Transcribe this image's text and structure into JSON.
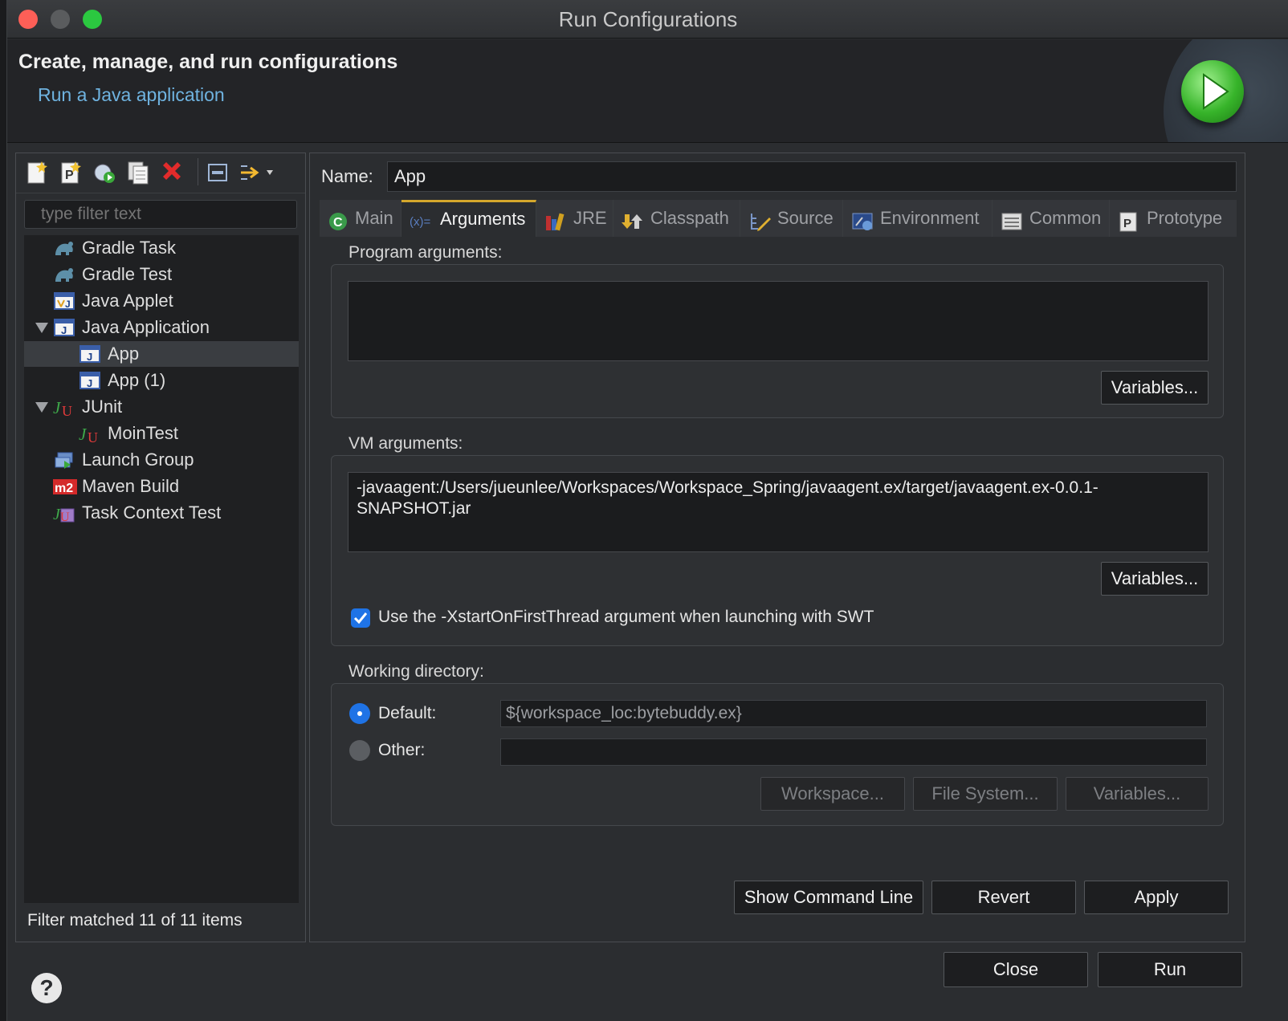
{
  "window": {
    "title": "Run Configurations"
  },
  "header": {
    "title": "Create, manage, and run configurations",
    "subtitle": "Run a Java application"
  },
  "left": {
    "toolbar": [
      {
        "name": "new-config-icon"
      },
      {
        "name": "new-prototype-icon"
      },
      {
        "name": "export-config-icon"
      },
      {
        "name": "duplicate-icon"
      },
      {
        "name": "delete-icon"
      },
      {
        "name": "collapse-all-icon"
      },
      {
        "name": "filter-menu-icon"
      }
    ],
    "filter_placeholder": "type filter text",
    "tree": [
      {
        "label": "Gradle Task",
        "icon": "gradle-icon",
        "level": 1
      },
      {
        "label": "Gradle Test",
        "icon": "gradle-icon",
        "level": 1
      },
      {
        "label": "Java Applet",
        "icon": "applet-icon",
        "level": 1
      },
      {
        "label": "Java Application",
        "icon": "java-app-icon",
        "level": 1,
        "expanded": true
      },
      {
        "label": "App",
        "icon": "java-app-icon",
        "level": 2,
        "selected": true
      },
      {
        "label": "App (1)",
        "icon": "java-app-icon",
        "level": 2
      },
      {
        "label": "JUnit",
        "icon": "junit-icon",
        "level": 1,
        "expanded": true
      },
      {
        "label": "MoinTest",
        "icon": "junit-icon",
        "level": 2
      },
      {
        "label": "Launch Group",
        "icon": "launch-group-icon",
        "level": 1
      },
      {
        "label": "Maven Build",
        "icon": "maven-icon",
        "level": 1
      },
      {
        "label": "Task Context Test",
        "icon": "task-context-icon",
        "level": 1
      }
    ],
    "status": "Filter matched 11 of 11 items"
  },
  "right": {
    "name_label": "Name:",
    "name_value": "App",
    "tabs": [
      {
        "label": "Main",
        "icon": "main-tab-icon",
        "active": false
      },
      {
        "label": "Arguments",
        "icon": "arguments-tab-icon",
        "active": true
      },
      {
        "label": "JRE",
        "icon": "jre-tab-icon",
        "active": false
      },
      {
        "label": "Classpath",
        "icon": "classpath-tab-icon",
        "active": false
      },
      {
        "label": "Source",
        "icon": "source-tab-icon",
        "active": false
      },
      {
        "label": "Environment",
        "icon": "environment-tab-icon",
        "active": false
      },
      {
        "label": "Common",
        "icon": "common-tab-icon",
        "active": false
      },
      {
        "label": "Prototype",
        "icon": "prototype-tab-icon",
        "active": false
      }
    ],
    "program_args": {
      "label": "Program arguments:",
      "value": "",
      "variables_button": "Variables..."
    },
    "vm_args": {
      "label": "VM arguments:",
      "value": "-javaagent:/Users/jueunlee/Workspaces/Workspace_Spring/javaagent.ex/target/javaagent.ex-0.0.1-\nSNAPSHOT.jar",
      "variables_button": "Variables...",
      "swt_checkbox_label": "Use the -XstartOnFirstThread argument when launching with SWT",
      "swt_checked": true
    },
    "working_dir": {
      "label": "Working directory:",
      "default_label": "Default:",
      "default_value": "${workspace_loc:bytebuddy.ex}",
      "other_label": "Other:",
      "other_value": "",
      "selected": "default",
      "workspace_button": "Workspace...",
      "filesystem_button": "File System...",
      "variables_button": "Variables..."
    },
    "buttons": {
      "show_command_line": "Show Command Line",
      "revert": "Revert",
      "apply": "Apply"
    }
  },
  "footer": {
    "help": "?",
    "close": "Close",
    "run": "Run"
  },
  "colors": {
    "accent": "#1f73e6",
    "link": "#6fb3e0",
    "active_tab_marker": "#d4a72c",
    "run_green": "#37b42a"
  }
}
